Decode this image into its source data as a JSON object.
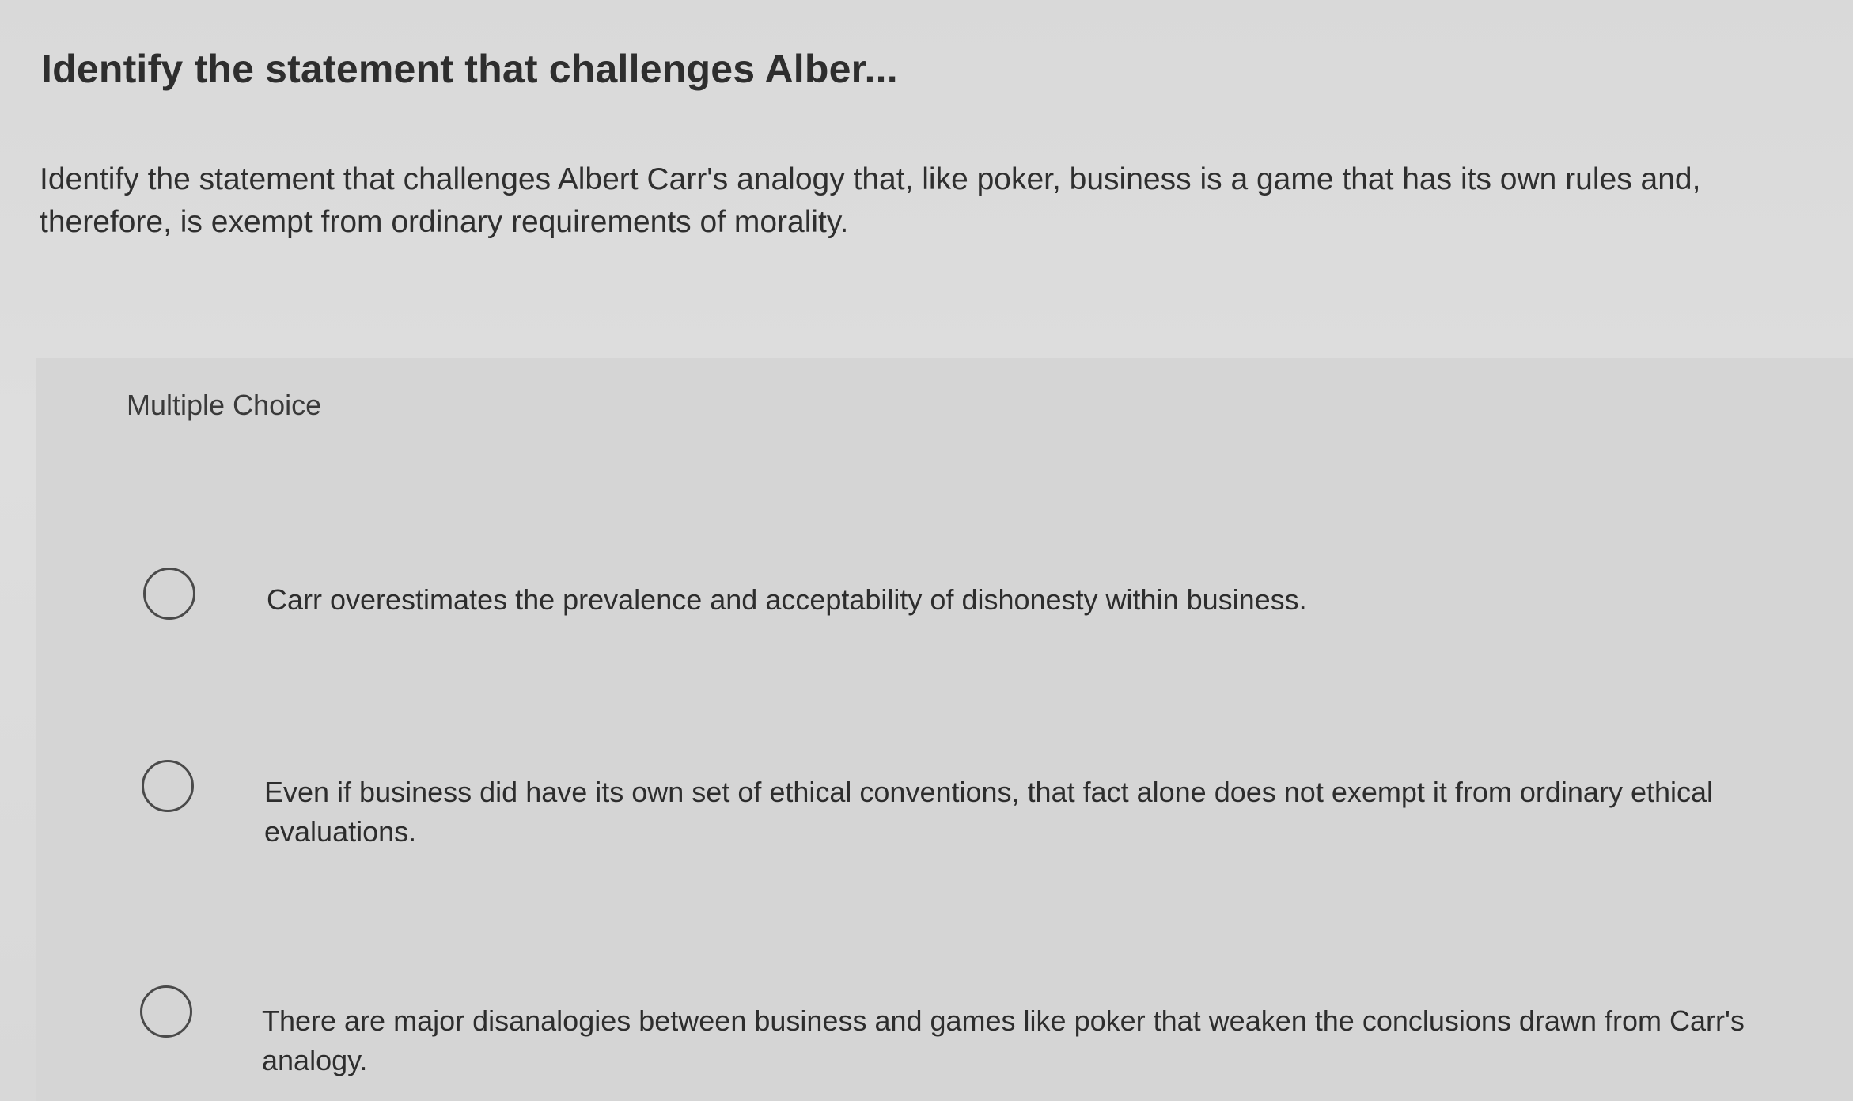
{
  "question": {
    "title": "Identify the statement that challenges Alber...",
    "prompt": "Identify the statement that challenges Albert Carr's analogy that, like poker, business is a game that has its own rules and, therefore, is exempt from ordinary requirements of morality."
  },
  "answer_panel": {
    "label": "Multiple Choice",
    "options": [
      {
        "text": "Carr overestimates the prevalence and acceptability of dishonesty within business."
      },
      {
        "text": "Even if business did have its own set of ethical conventions, that fact alone does not exempt it from ordinary ethical evaluations."
      },
      {
        "text": "There are major disanalogies between business and games like poker that weaken the conclusions drawn from Carr's analogy."
      }
    ]
  }
}
